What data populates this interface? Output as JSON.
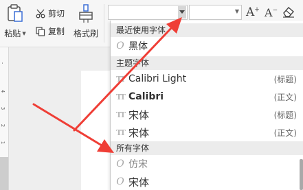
{
  "toolbar": {
    "paste_label": "粘贴",
    "cut_label": "剪切",
    "copy_label": "复制",
    "format_painter_label": "格式刷"
  },
  "font_selector": {
    "font_value": "",
    "size_value": "",
    "grow_icon": "font-grow-icon",
    "shrink_icon": "font-shrink-icon",
    "clear_icon": "eraser-icon"
  },
  "ruler": {
    "numbers": [
      "1",
      "2",
      "3",
      "4"
    ]
  },
  "font_dropdown": {
    "recent_header": "最近使用字体",
    "recent_items": [
      {
        "name": "黑体",
        "icon": "opentype-icon"
      }
    ],
    "theme_header": "主题字体",
    "theme_items": [
      {
        "name": "Calibri Light",
        "tag": "(标题)",
        "icon": "truetype-icon"
      },
      {
        "name": "Calibri",
        "tag": "(正文)",
        "icon": "truetype-icon"
      },
      {
        "name": "宋体",
        "tag": "(标题)",
        "icon": "truetype-icon"
      },
      {
        "name": "宋体",
        "tag": "(正文)",
        "icon": "truetype-icon"
      }
    ],
    "all_header": "所有字体",
    "all_items": [
      {
        "name": "仿宋",
        "icon": "opentype-icon"
      },
      {
        "name": "宋体",
        "icon": "opentype-icon"
      }
    ]
  },
  "colors": {
    "arrow": "#ef3e36",
    "section_bg": "#ececec",
    "ribbon_bg": "#f6f6f6"
  }
}
